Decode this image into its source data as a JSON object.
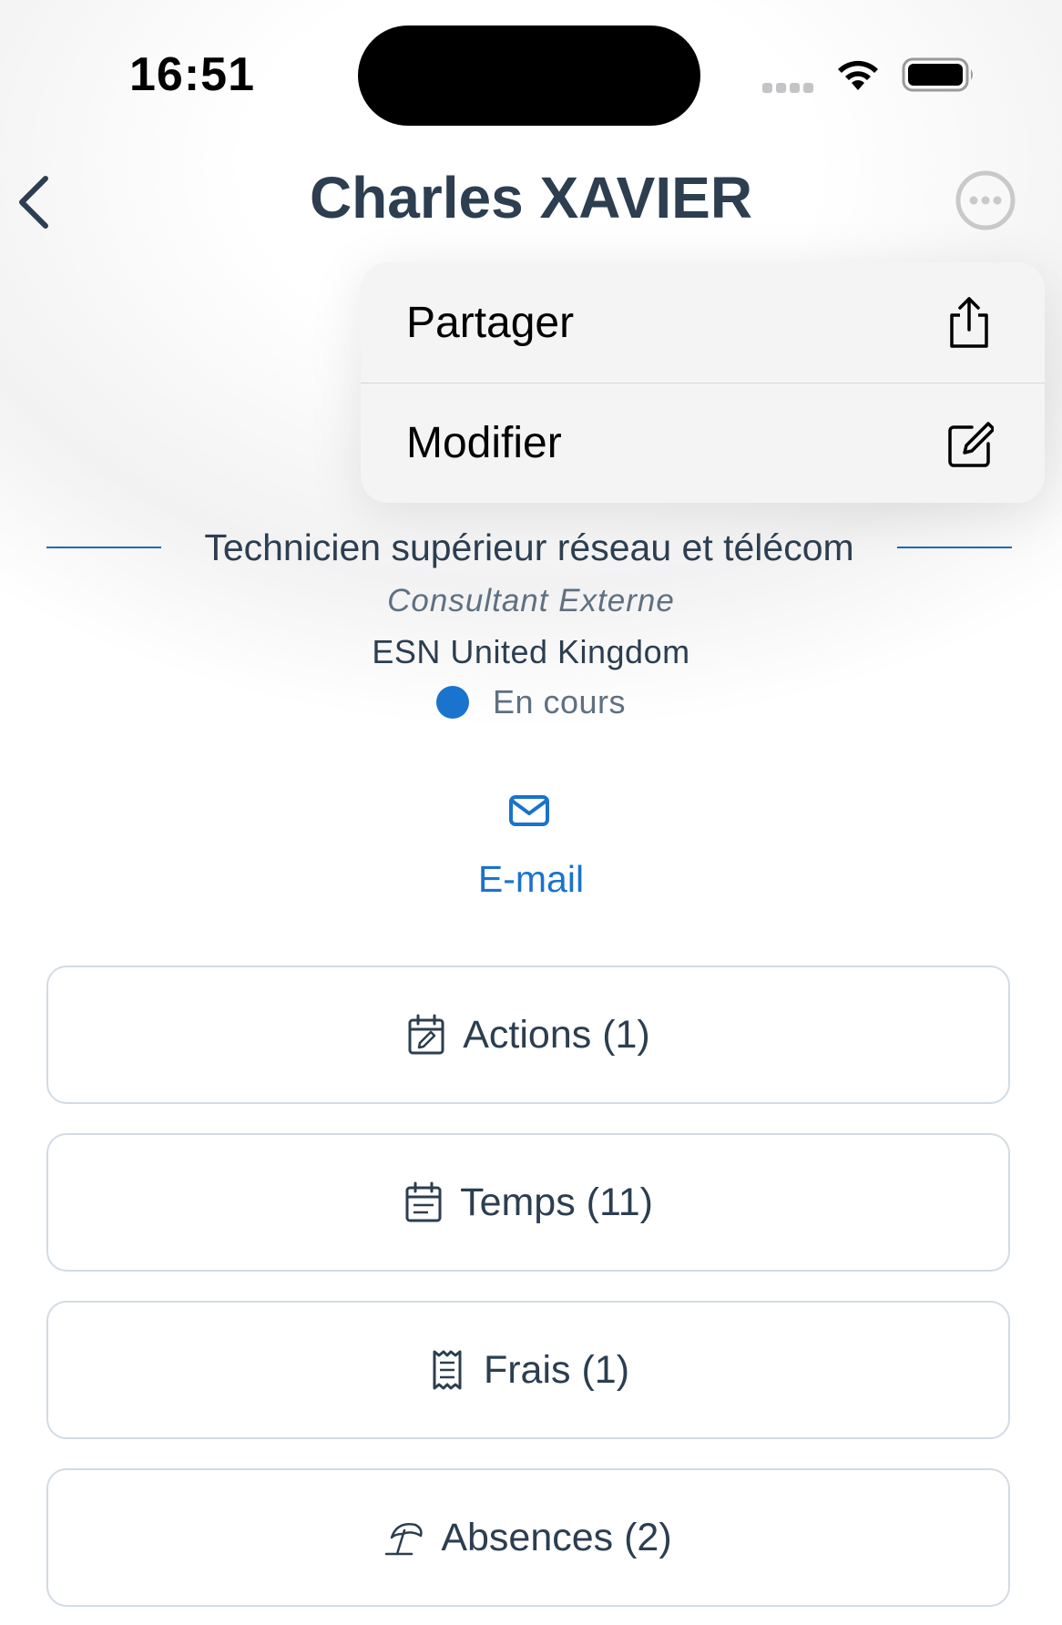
{
  "status_bar": {
    "time": "16:51"
  },
  "header": {
    "title": "Charles XAVIER"
  },
  "menu": {
    "items": [
      {
        "label": "Partager",
        "icon": "share-icon"
      },
      {
        "label": "Modifier",
        "icon": "edit-icon"
      }
    ]
  },
  "profile": {
    "job_title": "Technicien supérieur réseau et télécom",
    "contract_type": "Consultant Externe",
    "company": "ESN United Kingdom",
    "status": "En cours"
  },
  "contact": {
    "email_label": "E-mail"
  },
  "sections": [
    {
      "label": "Actions (1)",
      "icon": "calendar-edit-icon"
    },
    {
      "label": "Temps (11)",
      "icon": "calendar-list-icon"
    },
    {
      "label": "Frais (1)",
      "icon": "receipt-icon"
    },
    {
      "label": "Absences (2)",
      "icon": "beach-umbrella-icon"
    }
  ],
  "colors": {
    "accent": "#1a73cc",
    "text_dark": "#2c3e50",
    "text_muted": "#5f7080",
    "button_border": "#d3dbe4"
  }
}
